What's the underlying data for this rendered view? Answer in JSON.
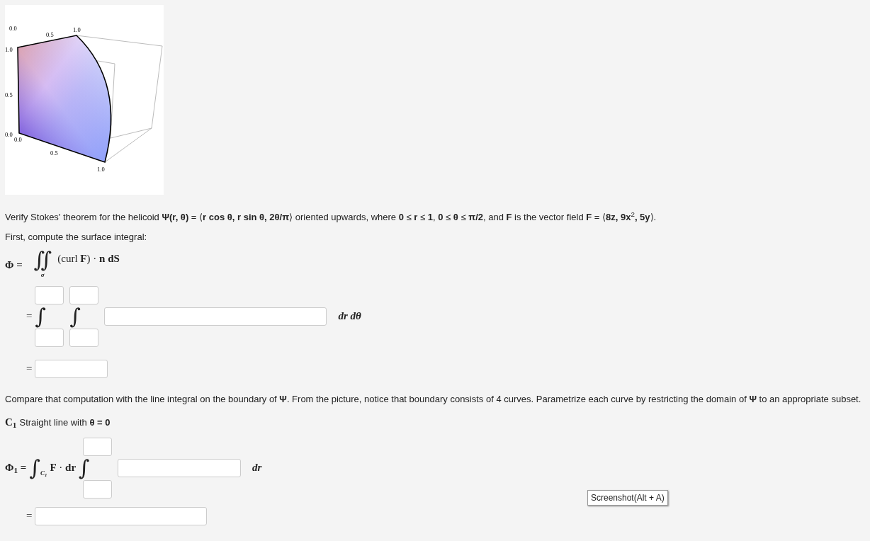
{
  "plot": {
    "tick_labels": [
      "0.0",
      "0.5",
      "1.0",
      "1.0",
      "0.5",
      "0.0",
      "0.0",
      "0.5",
      "1.0"
    ]
  },
  "intro": "Verify Stokes' theorem for the helicoid **Ψ(r, θ)** = ⟨**r cos θ, r sin θ, 2θ/π**⟩ oriented upwards, where **0** ≤ **r** ≤ **1**, **0** ≤ **θ** ≤ **π/2**, and **F** is the vector field **F** = ⟨**8z, 9x**$^{2}$**, 5y**⟩.",
  "first_step": "First, compute the surface integral:",
  "surface_integral": {
    "lhs": "Φ =",
    "sign": "∬",
    "subscript": "σ",
    "integrand": "(curl **F**) · **n** **dS**"
  },
  "iterated": {
    "equals": "=",
    "integrals": [
      {
        "sign": "∫"
      },
      {
        "sign": "∫"
      }
    ],
    "differentials": "dr dθ"
  },
  "result_1": {
    "equals": "="
  },
  "compare": "Compare that computation with the line integral on the boundary of **Ψ**. From the picture, notice that boundary consists of 4 curves. Parametrize each curve by restricting the domain of **Ψ** to an appropriate subset.",
  "curve": {
    "label": "C$_{1}$",
    "description": "Straight line with **θ = 0**"
  },
  "line_integral": {
    "lhs": "Φ$_{1}$ =",
    "sign": "∫",
    "subscript": "C$_{1}$",
    "integrand": "**F** · **dr**",
    "integrals": [
      {
        "sign": "∫"
      }
    ],
    "differential": "dr"
  },
  "result_2": {
    "equals": "="
  },
  "tooltip": "Screenshot(Alt + A)"
}
